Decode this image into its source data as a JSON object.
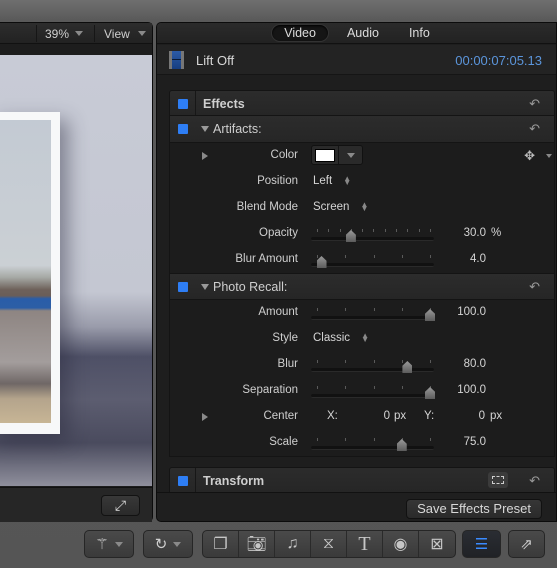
{
  "viewer": {
    "zoom_level": "39%",
    "view_menu_label": "View",
    "fullscreen_icon": "expand-arrows-icon"
  },
  "inspector": {
    "tabs": [
      {
        "label": "Video",
        "active": true
      },
      {
        "label": "Audio",
        "active": false
      },
      {
        "label": "Info",
        "active": false
      }
    ],
    "clip_name": "Lift Off",
    "timecode": "00:00:07:05.13",
    "accent_color": "#2e7ef5",
    "timecode_color": "#5b95db",
    "effects_section": {
      "title": "Effects",
      "enabled": true
    },
    "artifacts": {
      "title": "Artifacts:",
      "enabled": true,
      "params": {
        "color": {
          "label": "Color",
          "value": "#ffffff"
        },
        "position": {
          "label": "Position",
          "value": "Left"
        },
        "blend_mode": {
          "label": "Blend Mode",
          "value": "Screen"
        },
        "opacity": {
          "label": "Opacity",
          "value": "30.0",
          "unit": "%",
          "fraction": 0.3
        },
        "blur_amount": {
          "label": "Blur Amount",
          "value": "4.0",
          "fraction": 0.04
        }
      }
    },
    "photo_recall": {
      "title": "Photo Recall:",
      "enabled": true,
      "params": {
        "amount": {
          "label": "Amount",
          "value": "100.0",
          "fraction": 1.0
        },
        "style": {
          "label": "Style",
          "value": "Classic"
        },
        "blur": {
          "label": "Blur",
          "value": "80.0",
          "fraction": 0.8
        },
        "separation": {
          "label": "Separation",
          "value": "100.0",
          "fraction": 1.0
        },
        "center": {
          "label": "Center",
          "x_label": "X:",
          "x_value": "0",
          "x_unit": "px",
          "y_label": "Y:",
          "y_value": "0",
          "y_unit": "px"
        },
        "scale": {
          "label": "Scale",
          "value": "75.0",
          "fraction": 0.75
        }
      }
    },
    "transform_section": {
      "title": "Transform",
      "enabled": true
    },
    "save_preset_label": "Save Effects Preset"
  },
  "toolbar": {
    "buttons": [
      {
        "name": "enhancements-menu",
        "icon": "magic-wand-icon"
      },
      {
        "name": "retiming-menu",
        "icon": "speedometer-icon"
      }
    ],
    "browser_group": [
      {
        "name": "media-browser-effects",
        "icon": "film-overlay-icon"
      },
      {
        "name": "photos-browser",
        "icon": "camera-icon"
      },
      {
        "name": "music-browser",
        "icon": "music-note-icon"
      },
      {
        "name": "transitions-browser",
        "icon": "transition-icon"
      },
      {
        "name": "titles-browser",
        "icon": "title-t-icon"
      },
      {
        "name": "generators-browser",
        "icon": "generator-icon"
      },
      {
        "name": "themes-browser",
        "icon": "themes-icon"
      }
    ],
    "inspector_active": true
  }
}
